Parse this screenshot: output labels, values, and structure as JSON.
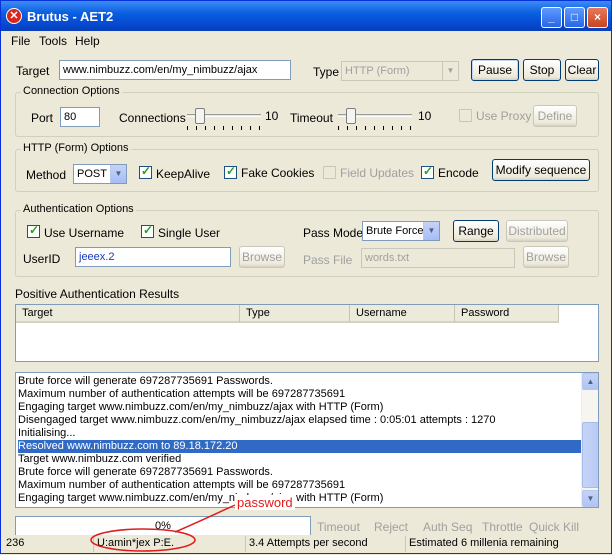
{
  "window": {
    "title": "Brutus - AET2",
    "controls": {
      "minimize": "_",
      "maximize": "□",
      "close": "×"
    },
    "app_icon": "✕"
  },
  "menu": [
    {
      "label": "File"
    },
    {
      "label": "Tools"
    },
    {
      "label": "Help"
    }
  ],
  "target": {
    "label": "Target",
    "value": "www.nimbuzz.com/en/my_nimbuzz/ajax",
    "type_label": "Type",
    "type_value": "HTTP (Form)",
    "pause_label": "Pause",
    "stop_label": "Stop",
    "clear_label": "Clear"
  },
  "connection": {
    "title": "Connection Options",
    "port_label": "Port",
    "port_value": "80",
    "connections_label": "Connections",
    "connections_value": "10",
    "timeout_label": "Timeout",
    "timeout_value": "10",
    "use_proxy_label": "Use Proxy",
    "define_label": "Define"
  },
  "http": {
    "title": "HTTP (Form) Options",
    "method_label": "Method",
    "method_value": "POST",
    "keepalive_label": "KeepAlive",
    "fake_cookies_label": "Fake Cookies",
    "field_updates_label": "Field Updates",
    "encode_label": "Encode",
    "modify_label": "Modify sequence"
  },
  "auth": {
    "title": "Authentication Options",
    "use_username_label": "Use Username",
    "single_user_label": "Single User",
    "pass_mode_label": "Pass Mode",
    "pass_mode_value": "Brute Force",
    "range_label": "Range",
    "distributed_label": "Distributed",
    "userid_label": "UserID",
    "userid_value": "jeeex.2",
    "browse_label": "Browse",
    "pass_file_label": "Pass File",
    "pass_file_value": "words.txt",
    "browse2_label": "Browse"
  },
  "results": {
    "title": "Positive Authentication Results",
    "columns": [
      "Target",
      "Type",
      "Username",
      "Password"
    ]
  },
  "log": [
    "Brute force will generate 697287735691 Passwords.",
    "Maximum number of authentication attempts will be 697287735691",
    "Engaging target www.nimbuzz.com/en/my_nimbuzz/ajax with HTTP (Form)",
    "Disengaged target www.nimbuzz.com/en/my_nimbuzz/ajax elapsed time : 0:05:01 attempts : 1270",
    "Initialising...",
    "Resolved www.nimbuzz.com to 89.18.172.20",
    "Target www.nimbuzz.com verified",
    "Brute force will generate 697287735691 Passwords.",
    "Maximum number of authentication attempts will be 697287735691",
    "Engaging target www.nimbuzz.com/en/my_nimbuzz/ajax with HTTP (Form)"
  ],
  "log_selected_index": 5,
  "progress": {
    "fraction": 0.0,
    "label": "0%"
  },
  "bottom_buttons": [
    "Timeout",
    "Reject",
    "Auth Seq",
    "Throttle",
    "Quick Kill"
  ],
  "status": {
    "count": "236",
    "current": "U:amin*jex  P:E.",
    "rate": "3.4 Attempts per second",
    "estimate": "Estimated 6 millenia remaining"
  },
  "annotation": {
    "text": "password",
    "color": "#e21b1b"
  }
}
